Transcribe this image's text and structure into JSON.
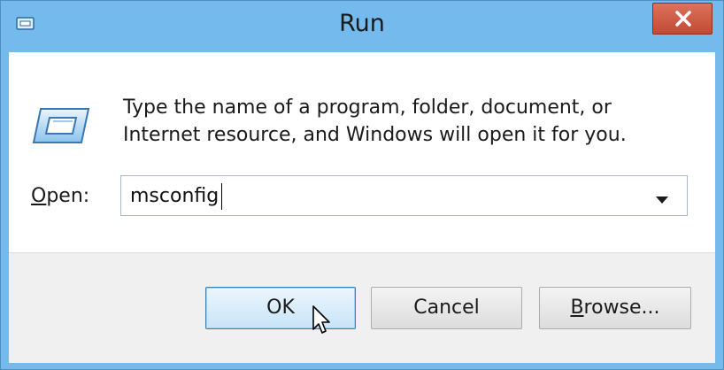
{
  "window": {
    "title": "Run",
    "close_glyph": "×"
  },
  "icons": {
    "title": "run-window-icon",
    "close": "close-icon",
    "program": "run-program-icon",
    "dropdown": "chevron-down-icon",
    "cursor": "mouse-pointer-icon"
  },
  "description": "Type the name of a program, folder, document, or Internet resource, and Windows will open it for you.",
  "open": {
    "label_mnemonic": "O",
    "label_rest": "pen:",
    "value": "msconfig"
  },
  "buttons": {
    "ok": "OK",
    "cancel": "Cancel",
    "browse_mnemonic": "B",
    "browse_rest": "rowse..."
  },
  "colors": {
    "titlebar": "#74baec",
    "close_button": "#c44a32",
    "ok_border": "#3c7fb1"
  }
}
